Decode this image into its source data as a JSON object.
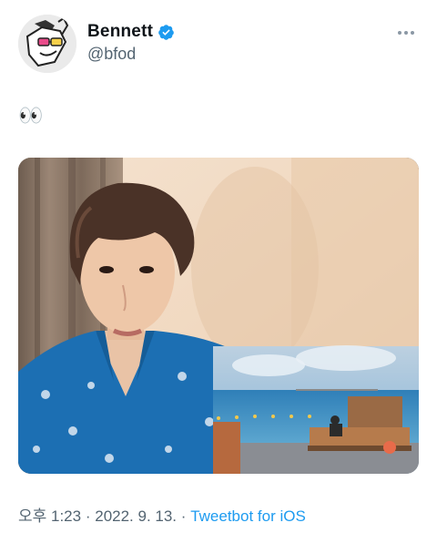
{
  "author": {
    "display_name": "Bennett",
    "handle": "@bfod",
    "verified": true
  },
  "tweet": {
    "text": "👀",
    "media_description_icon": "photo"
  },
  "meta": {
    "time": "오후 1:23",
    "separator": "·",
    "date": "2022. 9. 13.",
    "source": "Tweetbot for iOS"
  },
  "colors": {
    "link": "#1d9bf0",
    "secondary_text": "#536471",
    "verified": "#1d9bf0",
    "shirt": "#1c6fb3"
  },
  "icons": {
    "verified": "verified-badge-icon",
    "more": "more-horizontal-icon"
  }
}
